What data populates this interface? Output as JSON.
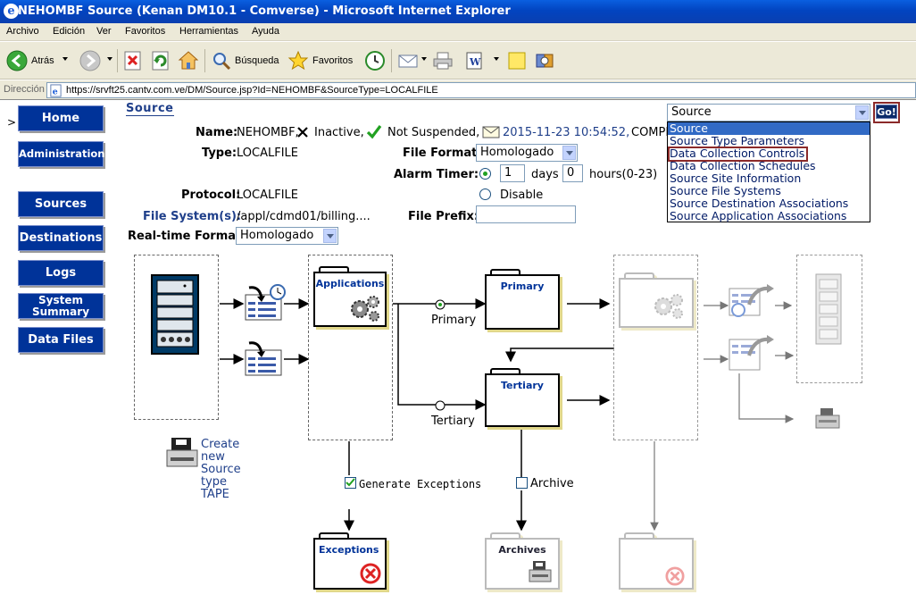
{
  "window": {
    "title": "NEHOMBF Source (Kenan DM10.1 - Comverse) - Microsoft Internet Explorer"
  },
  "menu": [
    "Archivo",
    "Edición",
    "Ver",
    "Favoritos",
    "Herramientas",
    "Ayuda"
  ],
  "toolbar": {
    "back": "Atrás",
    "search": "Búsqueda",
    "favorites": "Favoritos"
  },
  "address": {
    "label": "Dirección",
    "url": "https://srvft25.cantv.com.ve/DM/Source.jsp?Id=NEHOMBF&SourceType=LOCALFILE"
  },
  "nav": {
    "home": "Home",
    "admin": "Administration",
    "sources": "Sources",
    "destinations": "Destinations",
    "logs": "Logs",
    "summary_l1": "System",
    "summary_l2": "Summary",
    "datafiles": "Data Files"
  },
  "page": {
    "marker": ">",
    "heading": "Source"
  },
  "form": {
    "name_label": "Name:",
    "name_value": "NEHOMBF,",
    "inactive": "Inactive,",
    "not_suspended": "Not Suspended,",
    "timestamp": "2015-11-23 10:54:52,",
    "comp_trunc": "COMPI",
    "type_label": "Type:",
    "type_value": "LOCALFILE",
    "file_format_label": "File Format:",
    "file_format_value": "Homologado",
    "alarm_label": "Alarm Timer:",
    "days_value": "1",
    "days_label": "days",
    "hours_value": "0",
    "hours_label": "hours(0-23)",
    "disable_label": "Disable",
    "protocol_label": "Protocol:",
    "protocol_value": "LOCALFILE",
    "fs_label": "File System(s):",
    "fs_value": "/appl/cdmd01/billing....",
    "prefix_label": "File Prefix:",
    "prefix_value": "",
    "rt_label": "Real-time Format:",
    "rt_value": "Homologado"
  },
  "select": {
    "value": "Source",
    "go": "Go!",
    "options": [
      "Source",
      "Source Type Parameters",
      "Data Collection Controls",
      "Data Collection Schedules",
      "Source Site Information",
      "Source File Systems",
      "Source Destination Associations",
      "Source Application Associations"
    ]
  },
  "diagram": {
    "applications": "Applications",
    "primary_folder": "Primary",
    "tertiary_folder": "Tertiary",
    "primary_lbl": "Primary",
    "tertiary_lbl": "Tertiary",
    "exceptions": "Exceptions",
    "archives": "Archives",
    "gen_exceptions": "Generate Exceptions",
    "archive": "Archive",
    "create_l1": "Create",
    "create_l2": "new",
    "create_l3": "Source",
    "create_l4": "type",
    "create_l5": "TAPE"
  }
}
